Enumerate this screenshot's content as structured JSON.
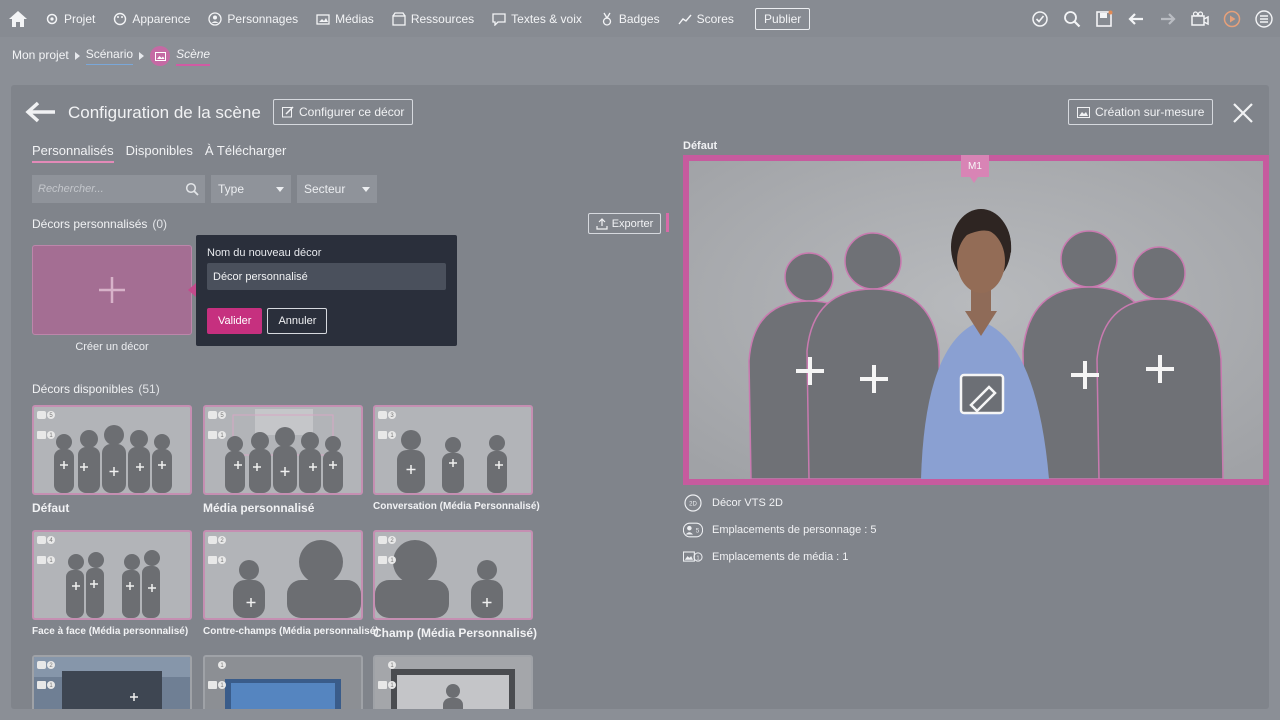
{
  "topnav": {
    "items": [
      {
        "label": "Projet",
        "icon": "gear-icon"
      },
      {
        "label": "Apparence",
        "icon": "palette-icon"
      },
      {
        "label": "Personnages",
        "icon": "person-icon"
      },
      {
        "label": "Médias",
        "icon": "media-icon"
      },
      {
        "label": "Ressources",
        "icon": "box-icon"
      },
      {
        "label": "Textes & voix",
        "icon": "speech-icon"
      },
      {
        "label": "Badges",
        "icon": "medal-icon"
      },
      {
        "label": "Scores",
        "icon": "chart-icon"
      }
    ],
    "publish": "Publier"
  },
  "breadcrumb": {
    "project": "Mon projet",
    "scenario": "Scénario",
    "scene": "Scène"
  },
  "panel": {
    "title": "Configuration de la scène",
    "configure_button": "Configurer ce décor",
    "custom_button": "Création sur-mesure"
  },
  "tabs": [
    "Personnalisés",
    "Disponibles",
    "À Télécharger"
  ],
  "filters": {
    "search_placeholder": "Rechercher...",
    "type": "Type",
    "sector": "Secteur"
  },
  "custom_section": {
    "title": "Décors personnalisés",
    "count": "(0)",
    "export": "Exporter",
    "create_label": "Créer un décor"
  },
  "popover": {
    "label": "Nom du nouveau décor",
    "value": "Décor personnalisé",
    "validate": "Valider",
    "cancel": "Annuler"
  },
  "available_section": {
    "title": "Décors disponibles",
    "count": "(51)"
  },
  "decors": [
    {
      "label": "Défaut",
      "chars": "5",
      "media": "1"
    },
    {
      "label": "Média personnalisé",
      "chars": "5",
      "media": "1"
    },
    {
      "label": "Conversation (Média Personnalisé)",
      "chars": "3",
      "media": "1"
    },
    {
      "label": "Face à face (Média personnalisé)",
      "chars": "4",
      "media": "1"
    },
    {
      "label": "Contre-champs (Média personnalisé)",
      "chars": "2",
      "media": "1"
    },
    {
      "label": "Champ (Média Personnalisé)",
      "chars": "2",
      "media": "1"
    },
    {
      "label": "",
      "chars": "2",
      "media": "1"
    },
    {
      "label": "",
      "chars": "1",
      "media": "1"
    },
    {
      "label": "",
      "chars": "1",
      "media": "1"
    }
  ],
  "preview": {
    "title": "Défaut",
    "media_slot": "M1",
    "info": [
      {
        "icon": "2d-icon",
        "badge": "2D",
        "text": "Décor VTS 2D"
      },
      {
        "icon": "character-slots-icon",
        "badge": "5",
        "text": "Emplacements de personnage : 5"
      },
      {
        "icon": "media-slots-icon",
        "badge": "1",
        "text": "Emplacements de média : 1"
      }
    ]
  },
  "colors": {
    "accent": "#c6307f",
    "pink_frame": "#c65b9e",
    "overlay": "#8b8f96"
  }
}
